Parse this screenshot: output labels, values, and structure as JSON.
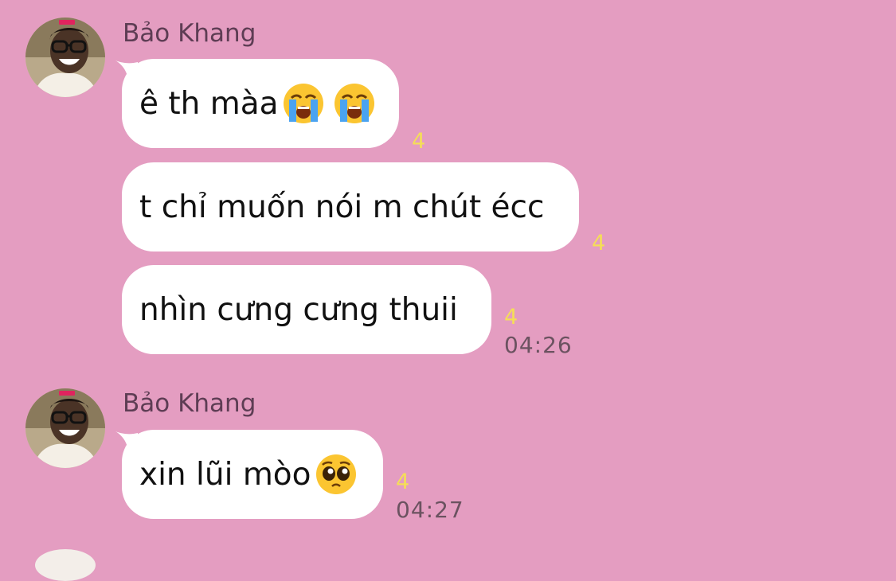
{
  "groups": [
    {
      "sender": "Bảo Khang",
      "avatar_icon": "profile-photo",
      "messages": [
        {
          "text": "ê th màa",
          "emoji": [
            "loudly-crying-face",
            "loudly-crying-face"
          ],
          "count": "4"
        },
        {
          "text": "t chỉ muốn nói m chút écc",
          "emoji": [],
          "count": "4"
        },
        {
          "text": "nhìn cưng cưng thuii",
          "emoji": [],
          "count": "4"
        }
      ],
      "time": "04:26"
    },
    {
      "sender": "Bảo Khang",
      "avatar_icon": "profile-photo",
      "messages": [
        {
          "text": "xin lũi mòo",
          "emoji": [
            "pleading-face"
          ],
          "count": "4"
        }
      ],
      "time": "04:27"
    }
  ],
  "colors": {
    "background": "#e49dc1",
    "bubble": "#ffffff",
    "count": "#f5de57",
    "sender": "#5e3d54"
  }
}
